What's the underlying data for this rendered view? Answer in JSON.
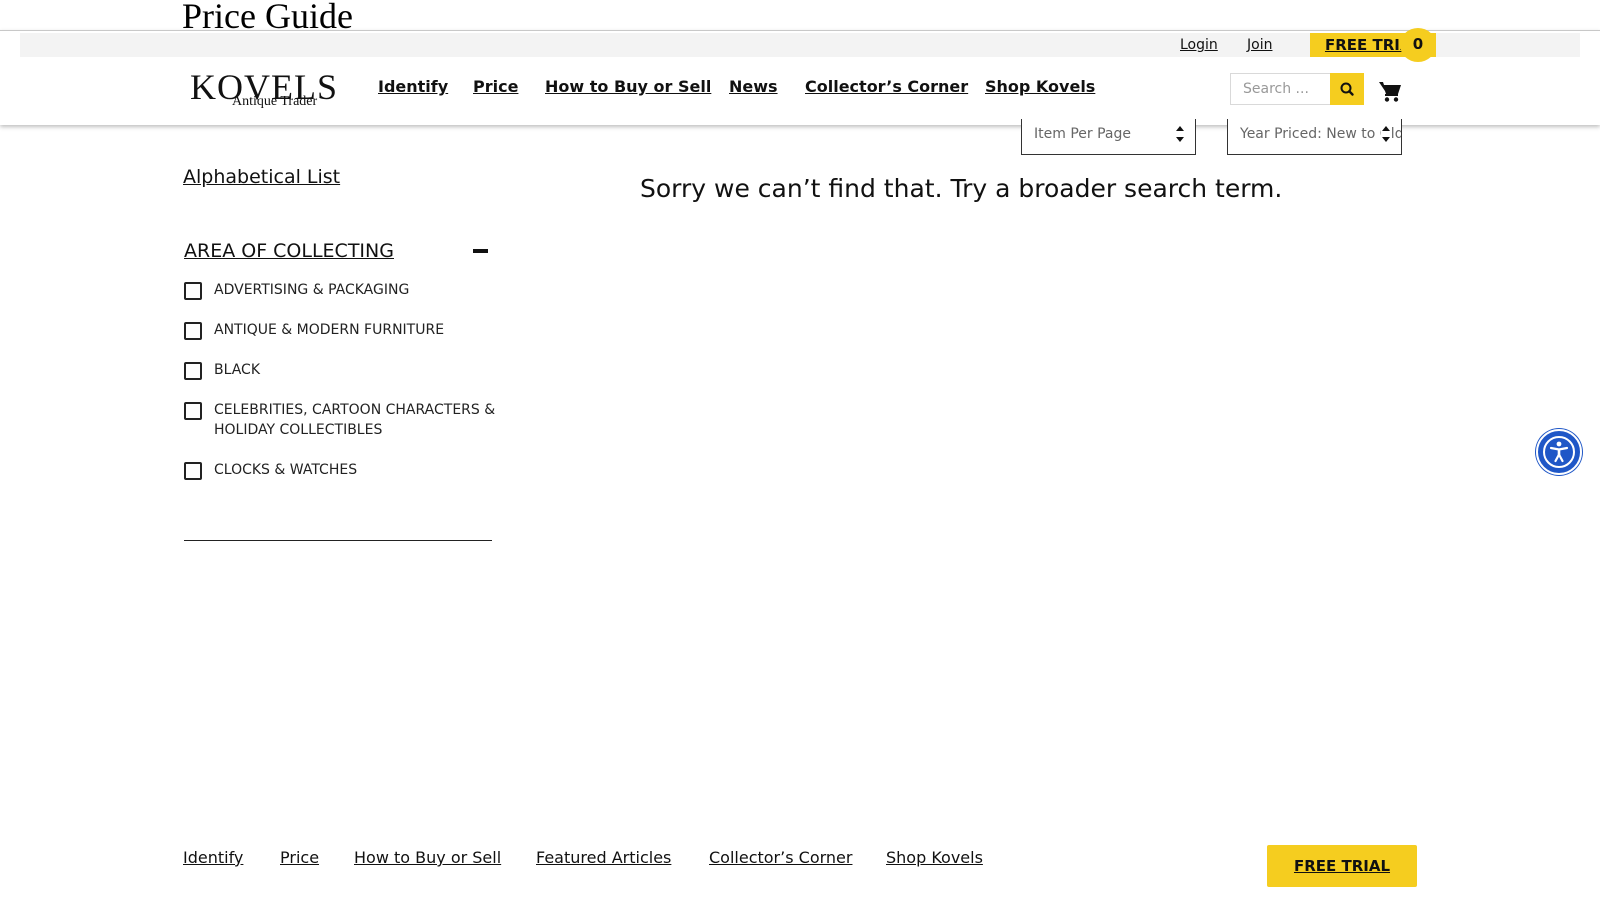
{
  "page": {
    "title": "Price Guide"
  },
  "topbar": {
    "login": "Login",
    "join": "Join",
    "free_trial": "FREE TRIAL"
  },
  "logo": {
    "main": "KOVELS",
    "sub": "Antique Trader"
  },
  "nav": {
    "items": [
      {
        "label": "Identify"
      },
      {
        "label": "Price"
      },
      {
        "label": "How to Buy or Sell"
      },
      {
        "label": "News"
      },
      {
        "label": "Collector’s Corner"
      },
      {
        "label": "Shop Kovels"
      }
    ]
  },
  "search": {
    "placeholder": "Search ...",
    "icon": "search-icon"
  },
  "cart": {
    "count": "0",
    "icon": "shopping-cart-icon"
  },
  "controls": {
    "per_page": "Item Per Page",
    "sort": "Year Priced: New to Old"
  },
  "sidebar": {
    "alpha_link": "Alphabetical List",
    "filter_heading": "AREA OF COLLECTING",
    "categories": [
      {
        "label": "ADVERTISING & PACKAGING"
      },
      {
        "label": "ANTIQUE & MODERN FURNITURE"
      },
      {
        "label": "BLACK"
      },
      {
        "label": "CELEBRITIES, CARTOON CHARACTERS & HOLIDAY COLLECTIBLES"
      },
      {
        "label": "CLOCKS & WATCHES"
      }
    ]
  },
  "main": {
    "no_results": "Sorry we can’t find that. Try a broader search term."
  },
  "footer": {
    "links": [
      {
        "label": "Identify"
      },
      {
        "label": "Price"
      },
      {
        "label": "How to Buy or Sell"
      },
      {
        "label": "Featured Articles"
      },
      {
        "label": "Collector’s Corner"
      },
      {
        "label": "Shop Kovels"
      }
    ],
    "free_trial": "FREE TRIAL"
  },
  "colors": {
    "accent": "#f5cd1f",
    "a11y": "#1f57c7"
  }
}
